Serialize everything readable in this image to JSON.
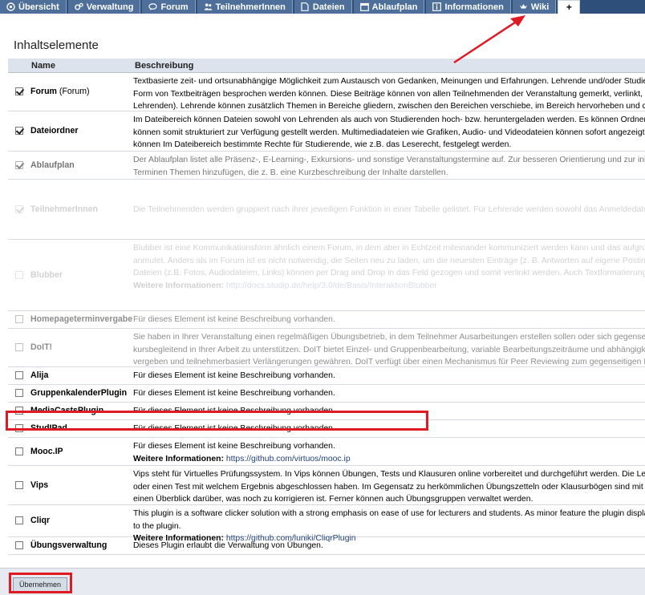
{
  "nav": {
    "tabs": [
      {
        "label": "Übersicht",
        "icon": "overview-icon"
      },
      {
        "label": "Verwaltung",
        "icon": "gears-icon"
      },
      {
        "label": "Forum",
        "icon": "speech-bubble-icon"
      },
      {
        "label": "TeilnehmerInnen",
        "icon": "people-icon"
      },
      {
        "label": "Dateien",
        "icon": "file-icon"
      },
      {
        "label": "Ablaufplan",
        "icon": "calendar-icon"
      },
      {
        "label": "Informationen",
        "icon": "info-icon"
      },
      {
        "label": "Wiki",
        "icon": "crown-icon"
      }
    ],
    "plus_label": "+"
  },
  "page": {
    "title": "Inhaltselemente",
    "col_name": "Name",
    "col_desc": "Beschreibung"
  },
  "rows": [
    {
      "name": "Forum",
      "name_sub": " (Forum)",
      "checked": true,
      "desc": [
        "Textbasierte zeit- und ortsunabhängige Möglichkeit zum Austausch von Gedanken, Meinungen und Erfahrungen. Lehrende und/oder Studierende könn",
        "Form von Textbeiträgen besprochen werden können. Diese Beiträge können von allen Teilnehmenden der Veranstaltung gemerkt, verlinkt, positiv bew",
        "Lehrenden). Lehrende können zusätzlich Themen in Bereiche gliedern, zwischen den Bereichen verschiebe, im Bereich hervorheben und diesen öffnen"
      ]
    },
    {
      "name": "Dateiordner",
      "name_sub": "",
      "checked": true,
      "desc": [
        "Im Dateibereich können Dateien sowohl von Lehrenden als auch von Studierenden hoch- bzw. heruntergeladen werden. Es können Ordner angelegt un",
        "können somit strukturiert zur Verfügung gestellt werden. Multimediadateien wie Grafiken, Audio- und Videodateien können sofort angezeigt bzw. abg",
        "können Im Dateibereich bestimmte Rechte für Studierende, wie z.B. das Leserecht, festgelegt werden."
      ]
    },
    {
      "name": "Ablaufplan",
      "name_sub": "",
      "checked": true,
      "desc": [
        "Der Ablaufplan listet alle Präsenz-, E-Learning-, Exkursions- und sonstige Veranstaltungstermine auf. Zur besseren Orientierung und zur inhal",
        "Terminen Themen hinzufügen, die z. B. eine Kurzbeschreibung der Inhalte darstellen."
      ]
    },
    {
      "name": "TeilnehmerInnen",
      "name_sub": "",
      "checked": true,
      "desc": [
        "Die Teilnehmenden werden gruppiert nach ihrer jeweiligen Funktion in einer Tabelle gelistet. Für Lehrende werden sowohl das Anmeldedatum als auch"
      ]
    },
    {
      "name": "Blubber",
      "name_sub": "",
      "checked": false,
      "desc": [
        "Blubber ist eine Kommunikationsform ähnlich einem Forum, in dem aber in Echtzeit miteinander kommuniziert werden kann und das aufgrund",
        "anmutet. Anders als im Forum ist es nicht notwendig, die Seiten neu zu laden, um die neuesten Einträge (z. B. Antworten auf eigene Postings) sehen zu kön",
        "Dateien (z.B. Fotos, Audiodateien, Links) können per Drag and Drop in das Feld gezogen und somit verlinkt werden. Auch Textformatierungen und das V"
      ],
      "more_label": "Weitere Informationen:",
      "more_link": "http://docs.studip.de/help/3.0/de/Basis/InteraktionBlubber"
    },
    {
      "name": "Homepageterminvergabe",
      "name_sub": "",
      "checked": false,
      "desc": [
        "Für dieses Element ist keine Beschreibung vorhanden."
      ]
    },
    {
      "name": "DoIT!",
      "name_sub": "",
      "checked": false,
      "desc": [
        "Sie haben in Ihrer Veranstaltung einen regelmäßigen Übungsbetrieb, in dem Teilnehmer Ausarbeitungen erstellen sollen oder sich gegenseitig bewerte",
        "kursbegleitend in Ihrer Arbeit zu unterstützen. DoIT bietet Einzel- und Gruppenbearbeitung, variable Bearbeitungszeiträume und abhängigkeitsorienti",
        "vergeben und teilnehmerbasiert Verlängerungen gewähren. DoIT verfügt über einen Mechanismus für Peer Reviewing zum gegenseitigen Bewerten de"
      ]
    },
    {
      "name": "Alija",
      "name_sub": "",
      "checked": false,
      "desc": [
        "Für dieses Element ist keine Beschreibung vorhanden."
      ]
    },
    {
      "name": "GruppenkalenderPlugin",
      "name_sub": "",
      "checked": false,
      "desc": [
        "Für dieses Element ist keine Beschreibung vorhanden."
      ]
    },
    {
      "name": "MediaCastsPlugin",
      "name_sub": "",
      "checked": false,
      "desc": [
        "Für dieses Element ist keine Beschreibung vorhanden."
      ]
    },
    {
      "name": "StudIPad",
      "name_sub": "",
      "checked": false,
      "desc": [
        "Für dieses Element ist keine Beschreibung vorhanden."
      ]
    },
    {
      "name": "Mooc.IP",
      "name_sub": "",
      "checked": false,
      "desc": [
        "Für dieses Element ist keine Beschreibung vorhanden."
      ],
      "more_label": "Weitere Informationen:",
      "more_link": "https://github.com/virtuos/mooc.ip"
    },
    {
      "name": "Vips",
      "name_sub": "",
      "checked": false,
      "desc": [
        "Vips steht für Virtuelles Prüfungssystem. In Vips können Übungen, Tests und Klausuren online vorbereitet und durchgeführt werden. Die Lehrenden er",
        "oder einen Test mit welchem Ergebnis abgeschlossen haben. Im Gegensatz zu herkömmlichen Übungszetteln oder Klausurbögen sind mit Vips alle Texte",
        "einen Überblick darüber, was noch zu korrigieren ist. Ferner können auch Übungsgruppen verwaltet werden."
      ]
    },
    {
      "name": "Cliqr",
      "name_sub": "",
      "checked": false,
      "desc": [
        "This plugin is a software clicker solution with a strong emphasis on ease of use for lecturers and students. As minor feature the plugin displays the URL o",
        "to the plugin."
      ],
      "more_label": "Weitere Informationen:",
      "more_link": "https://github.com/luniki/CliqrPlugin"
    },
    {
      "name": "Übungsverwaltung",
      "name_sub": "",
      "checked": false,
      "desc": [
        "Dieses Plugin erlaubt die Verwaltung von Übungen."
      ]
    }
  ],
  "footer": {
    "apply_label": "Übernehmen"
  },
  "annotation": {
    "color": "#e01a22"
  }
}
